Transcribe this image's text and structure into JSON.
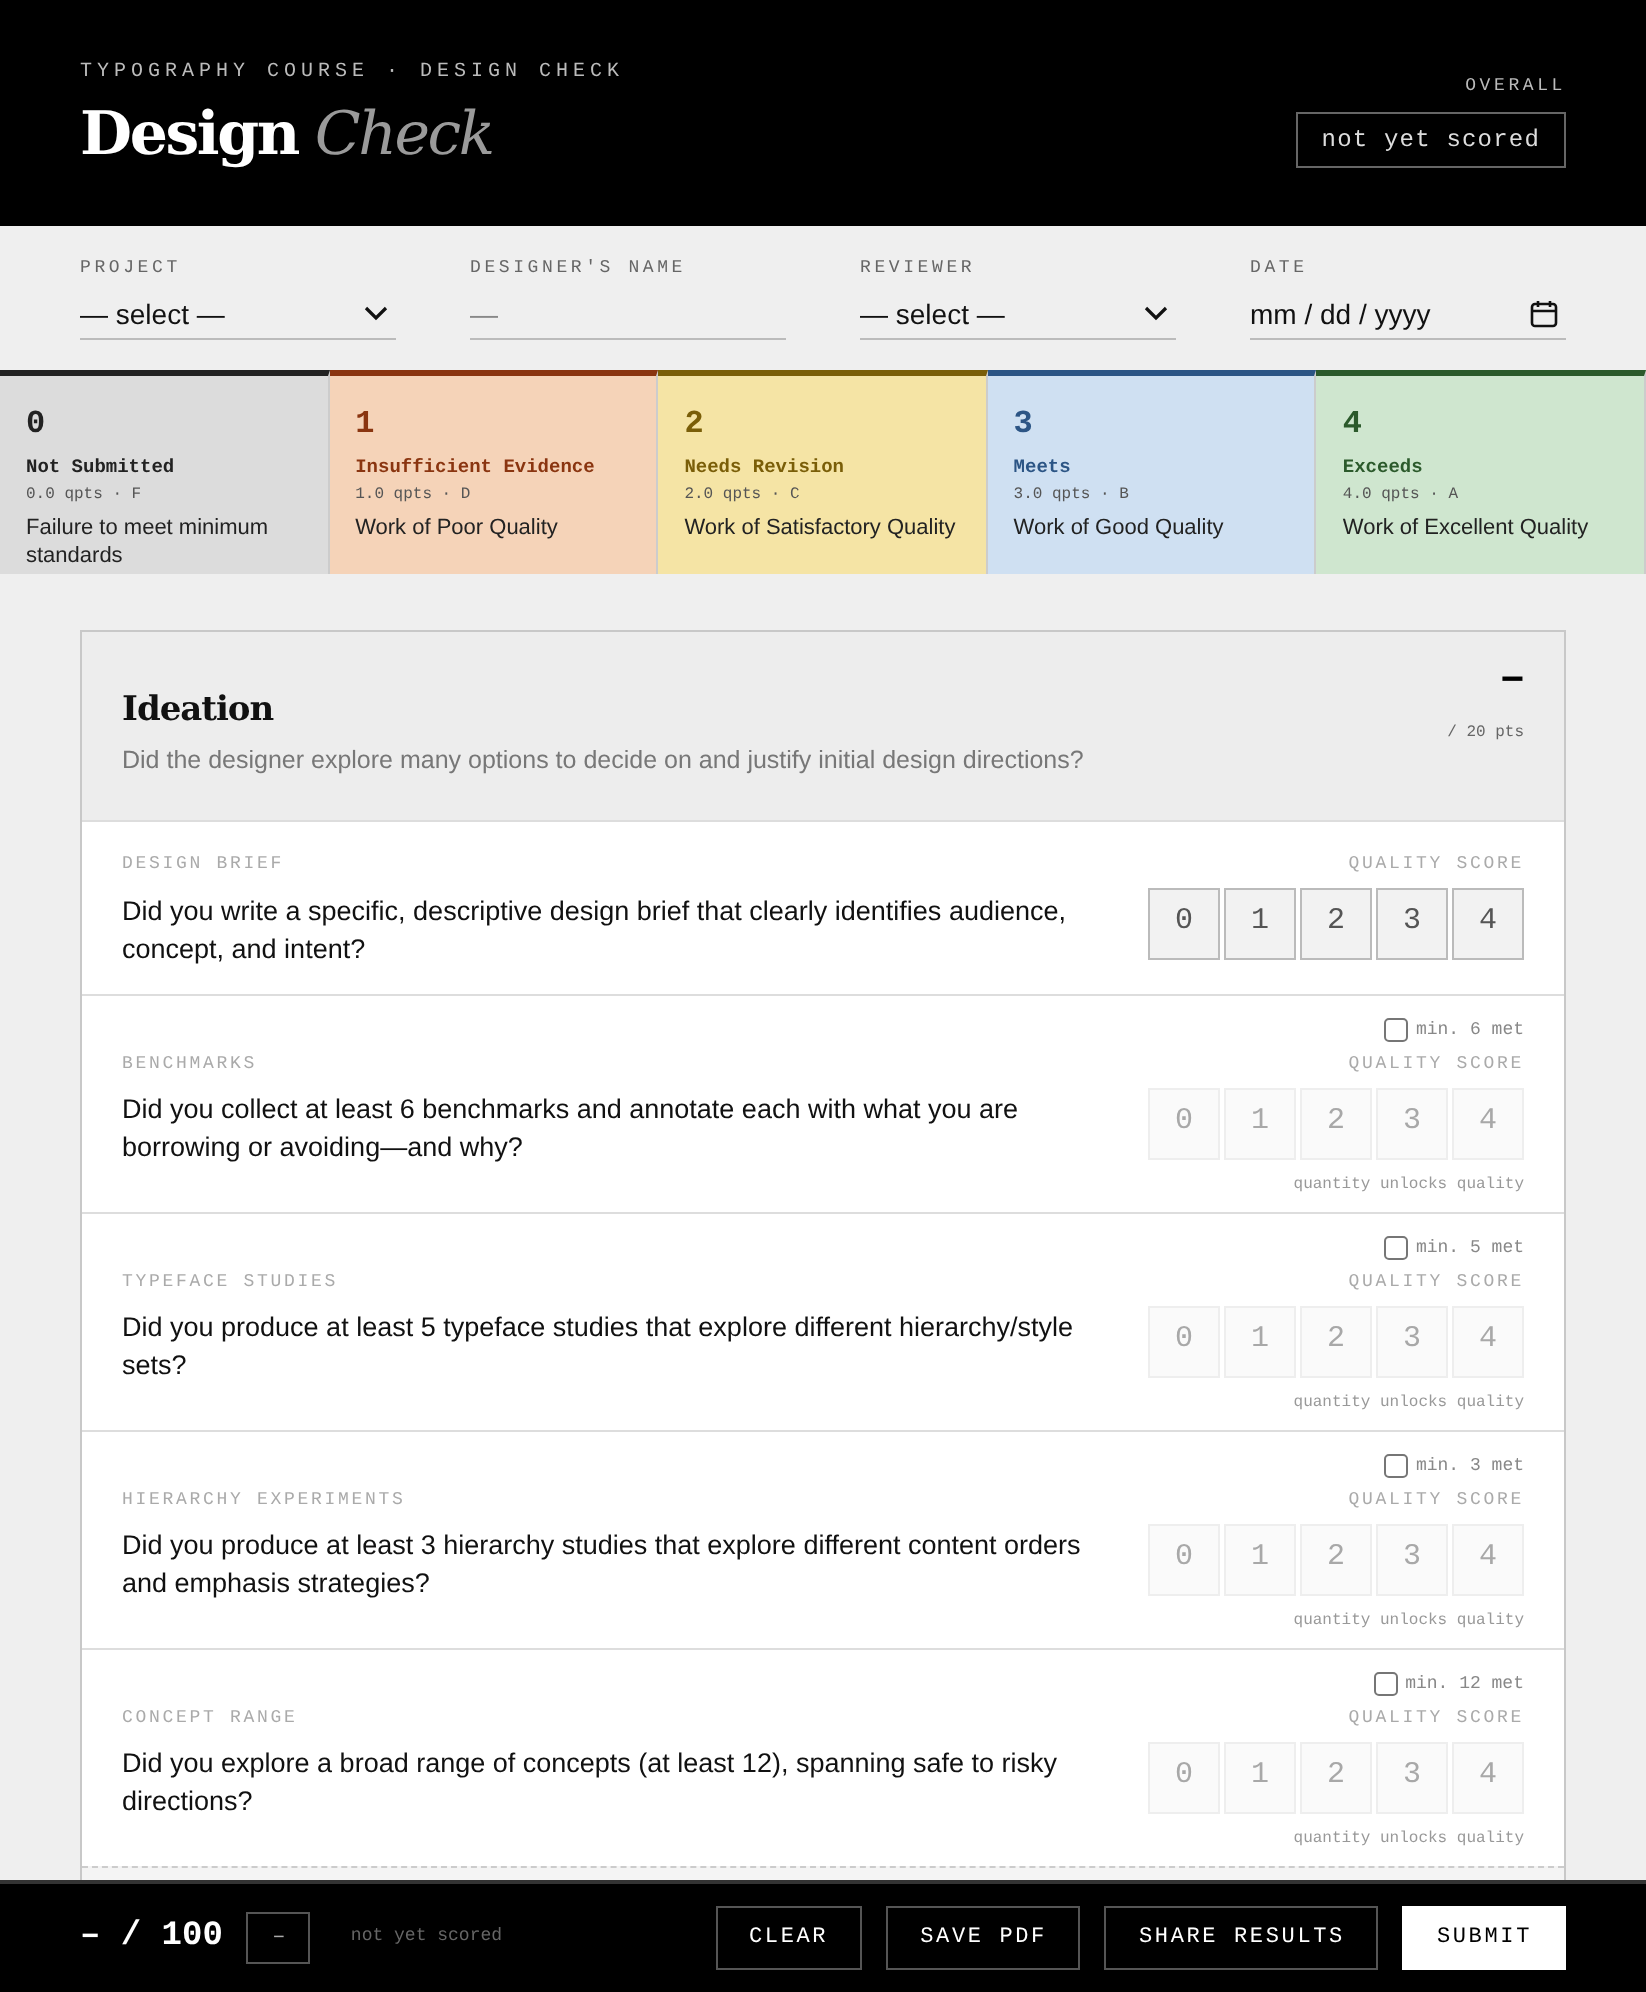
{
  "header": {
    "eyebrow": "TYPOGRAPHY COURSE · DESIGN CHECK",
    "title_main": "Design",
    "title_accent": "Check",
    "overall_label": "OVERALL",
    "overall_value": "not yet scored"
  },
  "fields": [
    {
      "kind": "select",
      "label": "PROJECT",
      "value": "— select —"
    },
    {
      "kind": "text",
      "label": "DESIGNER'S NAME",
      "placeholder": "—"
    },
    {
      "kind": "select",
      "label": "REVIEWER",
      "value": "— select —"
    },
    {
      "kind": "date",
      "label": "DATE",
      "placeholder": "mm / dd / yyyy"
    }
  ],
  "levels": [
    {
      "score": "0",
      "name": "Not Submitted",
      "meta": "0.0 qpts · F",
      "description": "Failure to meet minimum standards",
      "color": "#222222"
    },
    {
      "score": "1",
      "name": "Insufficient Evidence",
      "meta": "1.0 qpts · D",
      "description": "Work of Poor Quality",
      "color": "#8a3510"
    },
    {
      "score": "2",
      "name": "Needs Revision",
      "meta": "2.0 qpts · C",
      "description": "Work of Satisfactory Quality",
      "color": "#7a5e08"
    },
    {
      "score": "3",
      "name": "Meets",
      "meta": "3.0 qpts · B",
      "description": "Work of Good Quality",
      "color": "#2c5585"
    },
    {
      "score": "4",
      "name": "Exceeds",
      "meta": "4.0 qpts · A",
      "description": "Work of Excellent Quality",
      "color": "#2c5a2c"
    }
  ],
  "section": {
    "title": "Ideation",
    "description": "Did the designer explore many options to decide on and justify initial design directions?",
    "points": "/ 20 pts",
    "collapse_symbol": "−",
    "expanded": true,
    "questions": [
      {
        "kind": "plain",
        "label": "DESIGN BRIEF",
        "text": "Did you write a specific, descriptive design brief that clearly identifies audience, concept, and intent?",
        "score_label": "QUALITY SCORE",
        "scores": [
          "0",
          "1",
          "2",
          "3",
          "4"
        ],
        "disabled": false
      },
      {
        "kind": "gated",
        "label": "BENCHMARKS",
        "text": "Did you collect at least 6 benchmarks and annotate each with what you are borrowing or avoiding—and why?",
        "min_label": "min. 6 met",
        "checked": false,
        "score_label": "QUALITY SCORE",
        "scores": [
          "0",
          "1",
          "2",
          "3",
          "4"
        ],
        "disabled": true,
        "hint": "quantity unlocks quality"
      },
      {
        "kind": "gated",
        "label": "TYPEFACE STUDIES",
        "text": "Did you produce at least 5 typeface studies that explore different hierarchy/style sets?",
        "min_label": "min. 5 met",
        "checked": false,
        "score_label": "QUALITY SCORE",
        "scores": [
          "0",
          "1",
          "2",
          "3",
          "4"
        ],
        "disabled": true,
        "hint": "quantity unlocks quality"
      },
      {
        "kind": "gated",
        "label": "HIERARCHY EXPERIMENTS",
        "text": "Did you produce at least 3 hierarchy studies that explore different content orders and emphasis strategies?",
        "min_label": "min. 3 met",
        "checked": false,
        "score_label": "QUALITY SCORE",
        "scores": [
          "0",
          "1",
          "2",
          "3",
          "4"
        ],
        "disabled": true,
        "hint": "quantity unlocks quality"
      },
      {
        "kind": "gated",
        "label": "CONCEPT RANGE",
        "text": "Did you explore a broad range of concepts (at least 12), spanning safe to risky directions?",
        "min_label": "min. 12 met",
        "checked": false,
        "score_label": "QUALITY SCORE",
        "scores": [
          "0",
          "1",
          "2",
          "3",
          "4"
        ],
        "disabled": true,
        "hint": "quantity unlocks quality"
      }
    ]
  },
  "footer": {
    "total": "– / 100",
    "grade": "–",
    "status": "not yet scored",
    "buttons": [
      {
        "label": "CLEAR",
        "primary": false
      },
      {
        "label": "SAVE PDF",
        "primary": false
      },
      {
        "label": "SHARE RESULTS",
        "primary": false
      },
      {
        "label": "SUBMIT",
        "primary": true
      }
    ]
  }
}
